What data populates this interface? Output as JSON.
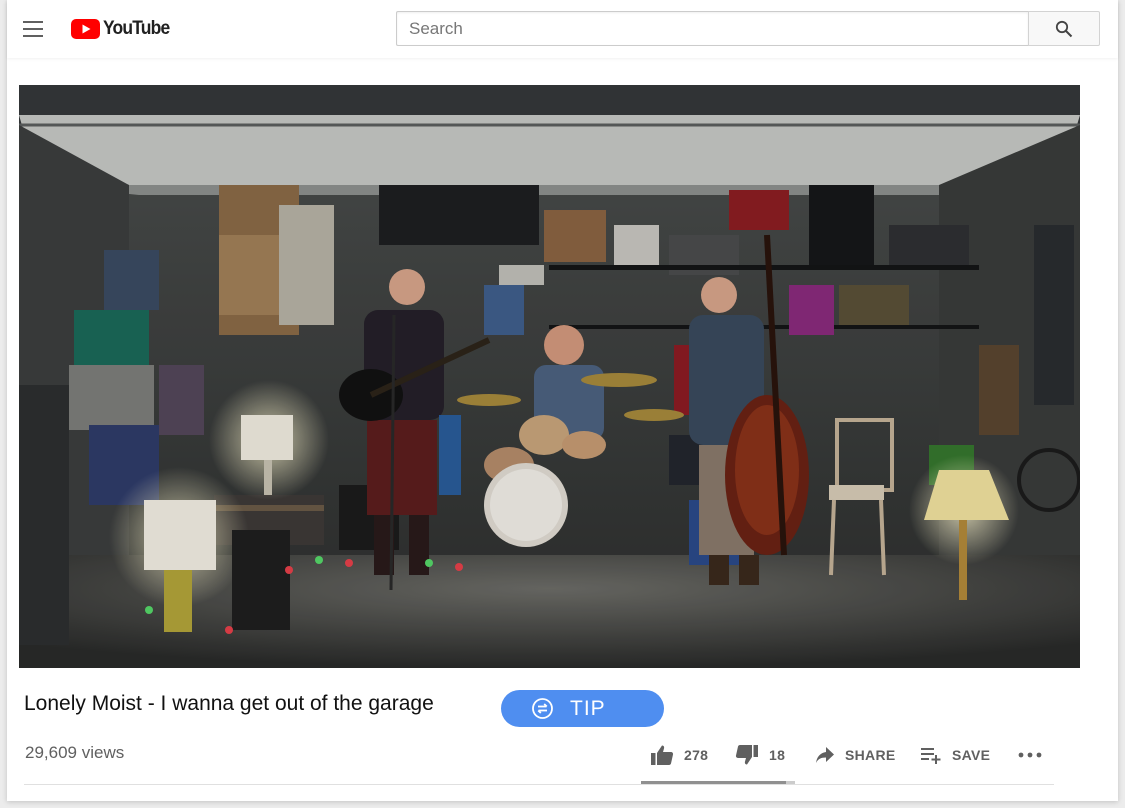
{
  "header": {
    "logo_text": "YouTube",
    "search_placeholder": "Search"
  },
  "video": {
    "title": "Lonely Moist - I wanna get out of the garage",
    "views": "29,609 views",
    "tip_label": "TIP"
  },
  "actions": {
    "likes": "278",
    "dislikes": "18",
    "share_label": "SHARE",
    "save_label": "SAVE",
    "like_ratio": 0.94
  },
  "colors": {
    "brand_red": "#ff0000",
    "tip_blue": "#4f8ef0",
    "action_gray": "#606060"
  },
  "icons": [
    "menu-icon",
    "youtube-logo-icon",
    "search-icon",
    "tip-icon",
    "thumbs-up-icon",
    "thumbs-down-icon",
    "share-icon",
    "playlist-add-icon",
    "more-icon"
  ]
}
